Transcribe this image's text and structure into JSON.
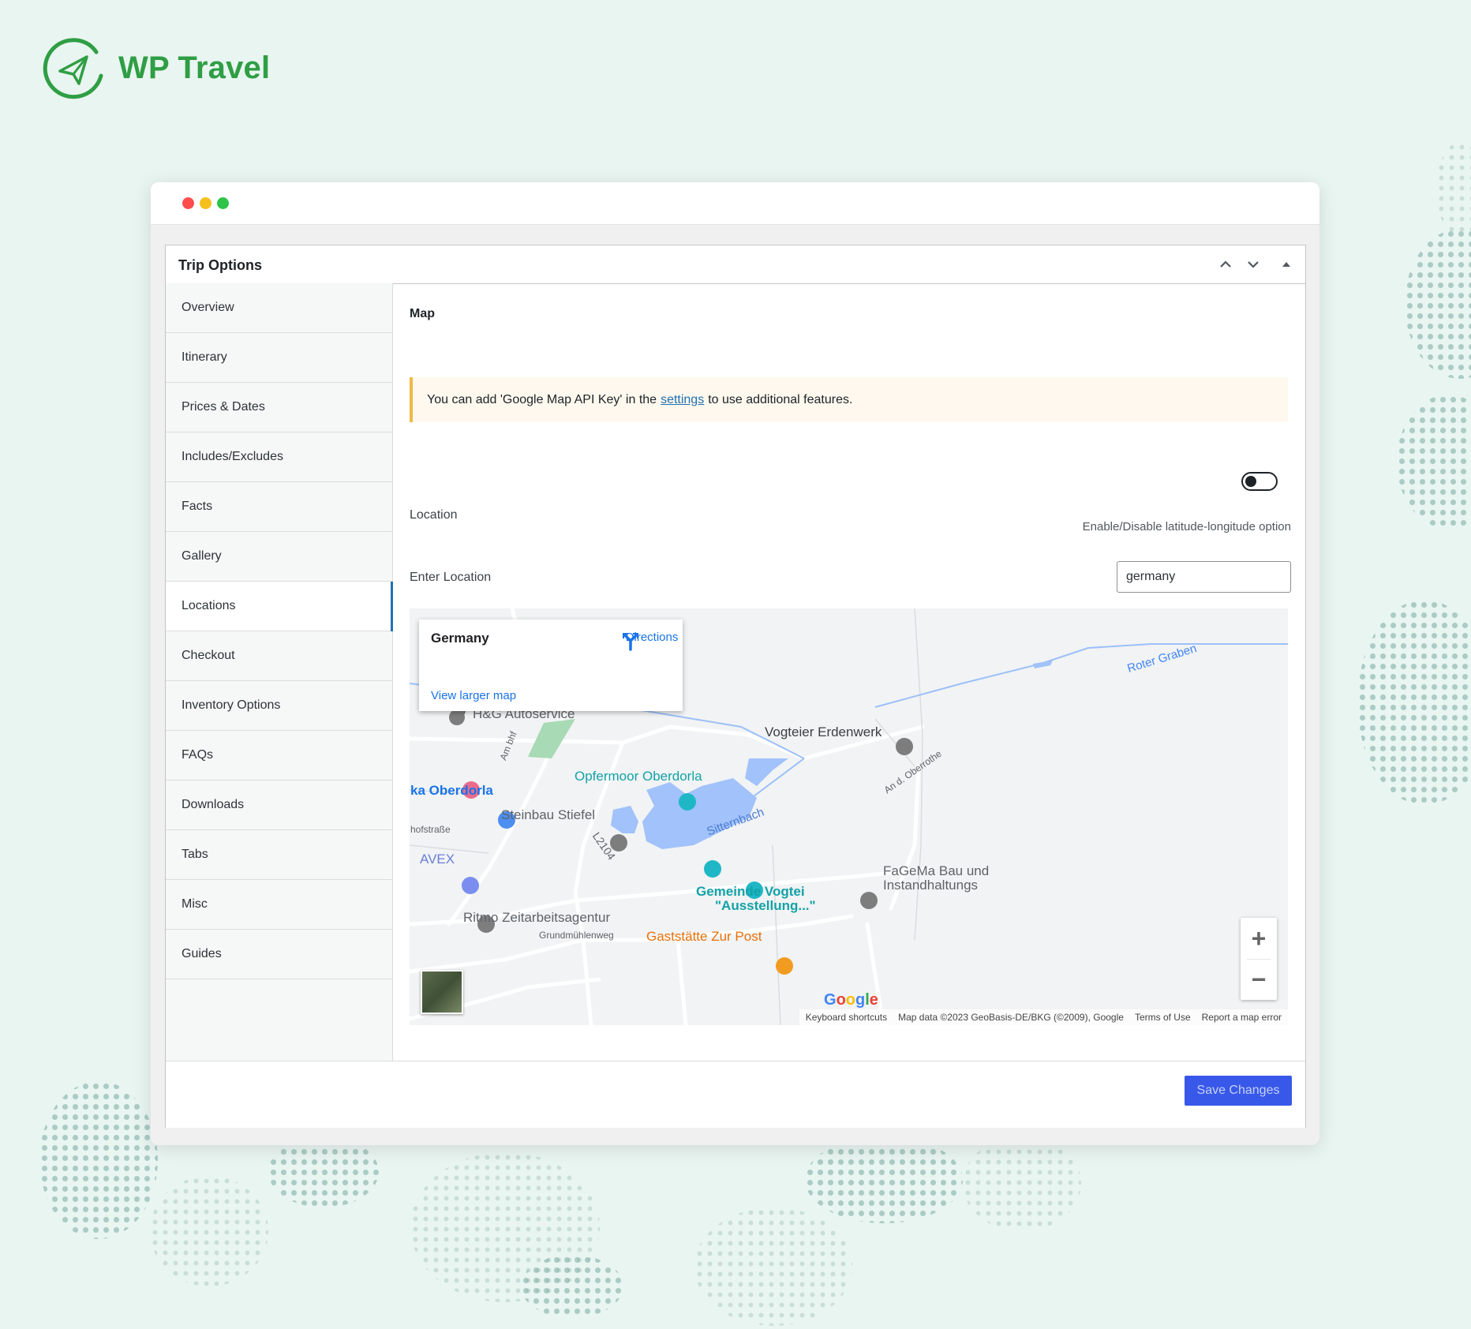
{
  "brand": {
    "name": "WP Travel",
    "color": "#2f9e44"
  },
  "window": {
    "traffic_lights": [
      "#ff5f57",
      "#febc2e",
      "#28c840"
    ]
  },
  "metabox": {
    "title": "Trip Options",
    "controls": [
      "chevron-up-icon",
      "chevron-down-icon",
      "triangle-up-icon"
    ]
  },
  "tabs": [
    {
      "label": "Overview"
    },
    {
      "label": "Itinerary"
    },
    {
      "label": "Prices & Dates"
    },
    {
      "label": "Includes/Excludes"
    },
    {
      "label": "Facts"
    },
    {
      "label": "Gallery"
    },
    {
      "label": "Locations",
      "active": true
    },
    {
      "label": "Checkout"
    },
    {
      "label": "Inventory Options"
    },
    {
      "label": "FAQs"
    },
    {
      "label": "Downloads"
    },
    {
      "label": "Tabs"
    },
    {
      "label": "Misc"
    },
    {
      "label": "Guides"
    }
  ],
  "panel": {
    "section_title": "Map",
    "notice": {
      "before": "You can add 'Google Map API Key' in the",
      "link": "settings",
      "after": "to use additional features."
    },
    "location_label": "Location",
    "toggle": {
      "state": "off",
      "help": "Enable/Disable latitude-longitude option"
    },
    "enter_location_label": "Enter Location",
    "enter_location_value": "germany"
  },
  "map": {
    "place_name": "Germany",
    "directions_label": "Directions",
    "view_larger": "View larger map",
    "pois": {
      "hg": "H&G Autoservice",
      "vogteier": "Vogteier Erdenwerk",
      "opfermoor": "Opfermoor Oberdorla",
      "oberdorla": "ka Oberdorla",
      "steinbau": "Steinbau Stiefel",
      "avex": "AVEX",
      "fagema1": "FaGeMa Bau und",
      "fagema2": "Instandhaltungs",
      "gemeinde1": "Gemeinde Vogtei",
      "gemeinde2": "\"Ausstellung...\"",
      "ritmo": "Ritmo Zeitarbeitsagentur",
      "gaststaette": "Gaststätte Zur Post"
    },
    "roads": {
      "roter_graben": "Roter Graben",
      "sitternbach": "Sitternbach",
      "am_bhf": "Am bhf",
      "oberrothe": "An d. Oberrothe",
      "l2104": "L2104",
      "hofstrasse": "hofstraße",
      "grundmuehlenweg": "Grundmühlenweg"
    },
    "google_logo": "Google",
    "attribution": {
      "shortcuts": "Keyboard shortcuts",
      "data": "Map data ©2023 GeoBasis-DE/BKG (©2009), Google",
      "terms": "Terms of Use",
      "report": "Report a map error"
    },
    "zoom_in": "+",
    "zoom_out": "−"
  },
  "footer": {
    "save_label": "Save Changes"
  }
}
